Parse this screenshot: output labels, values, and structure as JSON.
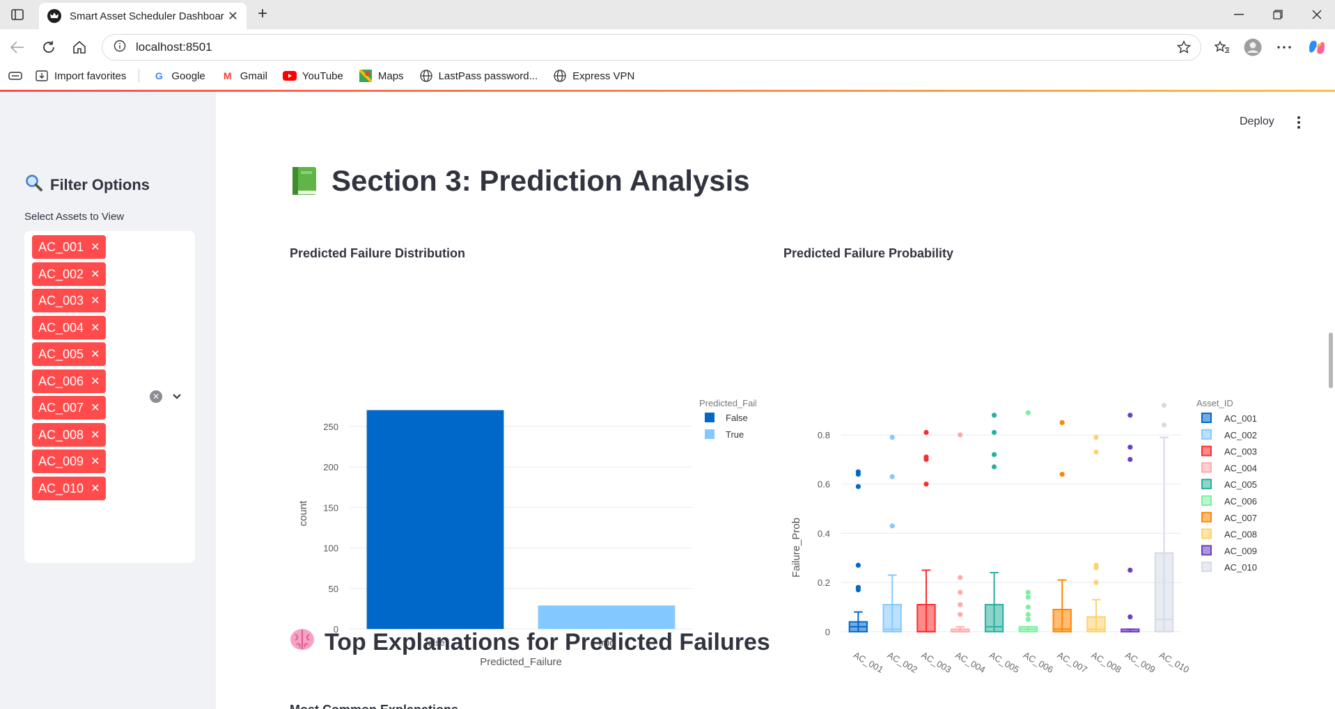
{
  "browser": {
    "tab_title": "Smart Asset Scheduler Dashboard",
    "url": "localhost:8501",
    "bookmarks": [
      "Import favorites",
      "Google",
      "Gmail",
      "YouTube",
      "Maps",
      "LastPass password...",
      "Express VPN"
    ]
  },
  "sidebar": {
    "heading": "Filter Options",
    "select_label": "Select Assets to View",
    "selected_assets": [
      "AC_001",
      "AC_002",
      "AC_003",
      "AC_004",
      "AC_005",
      "AC_006",
      "AC_007",
      "AC_008",
      "AC_009",
      "AC_010"
    ]
  },
  "header": {
    "deploy_label": "Deploy"
  },
  "main": {
    "section_title": "Section 3: Prediction Analysis",
    "explanations_title": "Top Explanations for Predicted Failures",
    "next_subheading": "Most Common Explanations"
  },
  "colors": {
    "false": "#0068c9",
    "true": "#83c9ff",
    "assets": [
      "#0068c9",
      "#83c9ff",
      "#ff2b2b",
      "#ffabab",
      "#29b09d",
      "#7defa1",
      "#ff8700",
      "#ffd16a",
      "#6d3fc0",
      "#d5dae5"
    ],
    "accent": "#ff4b4b"
  },
  "chart_data": [
    {
      "type": "bar",
      "title": "Predicted Failure Distribution",
      "categories": [
        "false",
        "true"
      ],
      "values": [
        270,
        29
      ],
      "xlabel": "Predicted_Failure",
      "ylabel": "count",
      "ylim": [
        0,
        285
      ],
      "yticks": [
        0,
        50,
        100,
        150,
        200,
        250
      ],
      "legend_title": "Predicted_Failure",
      "legend": [
        "False",
        "True"
      ],
      "legend_placement": "right",
      "grid": true
    },
    {
      "type": "box",
      "title": "Predicted Failure Probability",
      "xlabel": "Asset_ID",
      "ylabel": "Failure_Prob",
      "ylim": [
        -0.04,
        0.95
      ],
      "yticks": [
        0,
        0.2,
        0.4,
        0.6,
        0.8
      ],
      "ytick_labels": [
        "0",
        "0.2",
        "0.4",
        "0.6",
        "0.8"
      ],
      "legend_title": "Asset_ID",
      "legend_placement": "right",
      "grid": true,
      "series": [
        {
          "name": "AC_001",
          "q1": 0.0,
          "median": 0.02,
          "q3": 0.04,
          "whisker_low": 0.0,
          "whisker_high": 0.08,
          "outliers": [
            0.65,
            0.64,
            0.59,
            0.27,
            0.18,
            0.17
          ]
        },
        {
          "name": "AC_002",
          "q1": 0.0,
          "median": 0.01,
          "q3": 0.11,
          "whisker_low": 0.0,
          "whisker_high": 0.23,
          "outliers": [
            0.79,
            0.63,
            0.43
          ]
        },
        {
          "name": "AC_003",
          "q1": 0.0,
          "median": 0.0,
          "q3": 0.11,
          "whisker_low": 0.0,
          "whisker_high": 0.25,
          "outliers": [
            0.81,
            0.71,
            0.7,
            0.6
          ]
        },
        {
          "name": "AC_004",
          "q1": 0.0,
          "median": 0.0,
          "q3": 0.01,
          "whisker_low": 0.0,
          "whisker_high": 0.02,
          "outliers": [
            0.8,
            0.22,
            0.16,
            0.11,
            0.07
          ]
        },
        {
          "name": "AC_005",
          "q1": 0.0,
          "median": 0.02,
          "q3": 0.11,
          "whisker_low": 0.0,
          "whisker_high": 0.24,
          "outliers": [
            0.88,
            0.81,
            0.72,
            0.67
          ]
        },
        {
          "name": "AC_006",
          "q1": 0.0,
          "median": 0.01,
          "q3": 0.02,
          "whisker_low": 0.0,
          "whisker_high": 0.02,
          "outliers": [
            0.89,
            0.16,
            0.14,
            0.1,
            0.07,
            0.05
          ]
        },
        {
          "name": "AC_007",
          "q1": 0.0,
          "median": 0.01,
          "q3": 0.09,
          "whisker_low": 0.0,
          "whisker_high": 0.21,
          "outliers": [
            0.85,
            0.64
          ]
        },
        {
          "name": "AC_008",
          "q1": 0.0,
          "median": 0.01,
          "q3": 0.06,
          "whisker_low": 0.0,
          "whisker_high": 0.13,
          "outliers": [
            0.79,
            0.73,
            0.27,
            0.26,
            0.2
          ]
        },
        {
          "name": "AC_009",
          "q1": 0.0,
          "median": 0.0,
          "q3": 0.01,
          "whisker_low": 0.0,
          "whisker_high": 0.01,
          "outliers": [
            0.88,
            0.75,
            0.7,
            0.25,
            0.06
          ]
        },
        {
          "name": "AC_010",
          "q1": 0.0,
          "median": 0.05,
          "q3": 0.32,
          "whisker_low": 0.0,
          "whisker_high": 0.79,
          "outliers": [
            0.92,
            0.84
          ]
        }
      ]
    }
  ]
}
